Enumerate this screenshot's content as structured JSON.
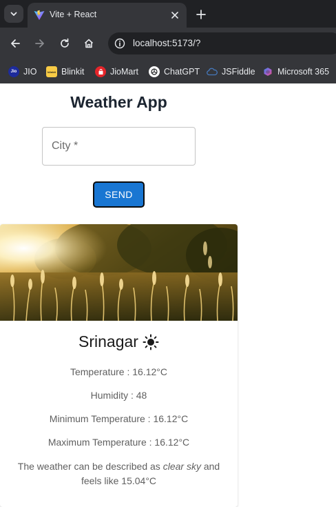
{
  "browser": {
    "tab_title": "Vite + React",
    "url": "localhost:5173/?",
    "bookmarks": [
      {
        "label": "JIO",
        "icon": "jio-icon",
        "color": "#1d2b9c"
      },
      {
        "label": "Blinkit",
        "icon": "blinkit-icon",
        "color": "#f8cb46"
      },
      {
        "label": "JioMart",
        "icon": "jiomart-icon",
        "color": "#e5252a"
      },
      {
        "label": "ChatGPT",
        "icon": "chatgpt-icon",
        "color": "#ffffff"
      },
      {
        "label": "JSFiddle",
        "icon": "jsfiddle-icon",
        "color": "#4679bd"
      },
      {
        "label": "Microsoft 365",
        "icon": "microsoft365-icon",
        "color": "#7b5bd6"
      }
    ]
  },
  "app": {
    "title": "Weather App",
    "city_placeholder": "City *",
    "send_label": "SEND",
    "accent_color": "#1976d2"
  },
  "card": {
    "image": "sunlit-grass-field",
    "city": "Srinagar",
    "weather_icon": "sun-icon",
    "temperature": "Temperature : 16.12°C",
    "humidity": "Humidity : 48",
    "min_temp": "Minimum Temperature : 16.12°C",
    "max_temp": "Maximum Temperature : 16.12°C",
    "desc_prefix": "The weather can be described as",
    "desc_condition": "clear sky",
    "desc_middle": "and feels like",
    "desc_feels": "15.04°C"
  }
}
